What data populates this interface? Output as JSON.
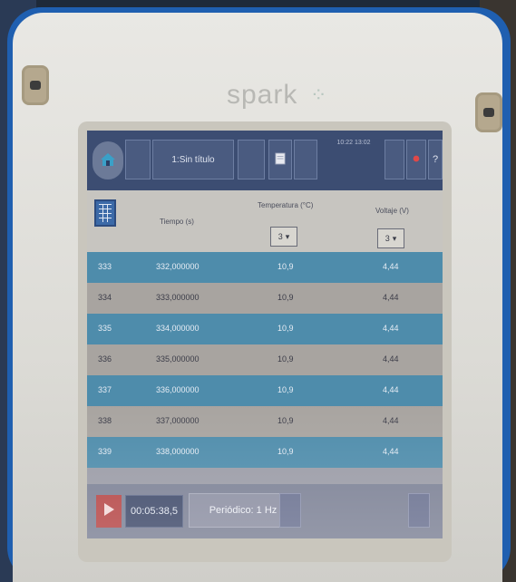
{
  "device": {
    "brand": "spark",
    "brand_mark": "⁘"
  },
  "toolbar": {
    "title": "1:Sin título",
    "clock": "10:22\n13:02",
    "help_label": "?"
  },
  "table": {
    "columns": {
      "tiempo": "Tiempo (s)",
      "temperatura": "Temperatura (°C)",
      "voltaje": "Voltaje (V)"
    },
    "temp_unit_selector": {
      "value": "3",
      "arrow": "▾"
    },
    "volt_unit_selector": {
      "value": "3",
      "arrow": "▾"
    },
    "rows": [
      {
        "n": "333",
        "t": "332,000000",
        "temp": "10,9",
        "v": "4,44"
      },
      {
        "n": "334",
        "t": "333,000000",
        "temp": "10,9",
        "v": "4,44"
      },
      {
        "n": "335",
        "t": "334,000000",
        "temp": "10,9",
        "v": "4,44"
      },
      {
        "n": "336",
        "t": "335,000000",
        "temp": "10,9",
        "v": "4,44"
      },
      {
        "n": "337",
        "t": "336,000000",
        "temp": "10,9",
        "v": "4,44"
      },
      {
        "n": "338",
        "t": "337,000000",
        "temp": "10,9",
        "v": "4,44"
      },
      {
        "n": "339",
        "t": "338,000000",
        "temp": "10,9",
        "v": "4,44"
      }
    ]
  },
  "bottom": {
    "timer": "00:05:38,5",
    "mode": "Periódico: 1 Hz"
  },
  "colors": {
    "toolbar": "#3c4d72",
    "row_dark": "#4e8cab",
    "row_light": "#a8a4a0",
    "record": "#b54646"
  }
}
